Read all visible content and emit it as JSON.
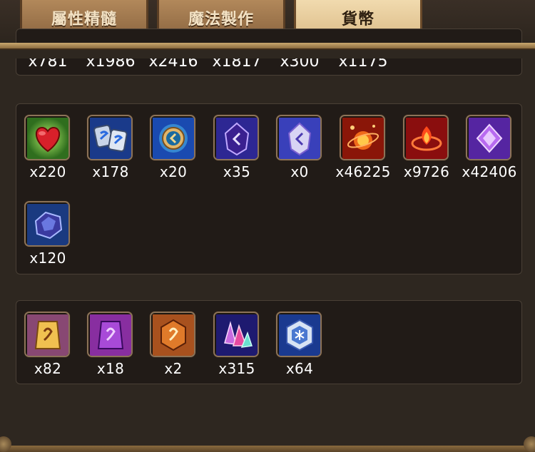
{
  "tabs": [
    {
      "label": "屬性精髓"
    },
    {
      "label": "魔法製作"
    },
    {
      "label": "貨幣"
    }
  ],
  "partial_row_counts": [
    "x781",
    "x1986",
    "x2416",
    "x1817",
    "x300",
    "x1175"
  ],
  "section1": {
    "items": [
      {
        "icon": "heart-icon",
        "count": "x220"
      },
      {
        "icon": "rune-pair-icon",
        "count": "x178"
      },
      {
        "icon": "coin-icon",
        "count": "x20"
      },
      {
        "icon": "violet-crystal-icon",
        "count": "x35"
      },
      {
        "icon": "white-crystal-icon",
        "count": "x0"
      },
      {
        "icon": "fire-orbit-icon",
        "count": "x46225"
      },
      {
        "icon": "flame-swirl-icon",
        "count": "x9726"
      },
      {
        "icon": "purple-diamond-icon",
        "count": "x42406"
      },
      {
        "icon": "blue-ore-icon",
        "count": "x120"
      }
    ]
  },
  "section2": {
    "items": [
      {
        "icon": "mystic-scroll-gold-icon",
        "count": "x82"
      },
      {
        "icon": "mystic-scroll-purple-icon",
        "count": "x18"
      },
      {
        "icon": "mystic-scroll-orange-icon",
        "count": "x2"
      },
      {
        "icon": "crystal-shards-icon",
        "count": "x315"
      },
      {
        "icon": "ice-hexagon-icon",
        "count": "x64"
      }
    ]
  }
}
